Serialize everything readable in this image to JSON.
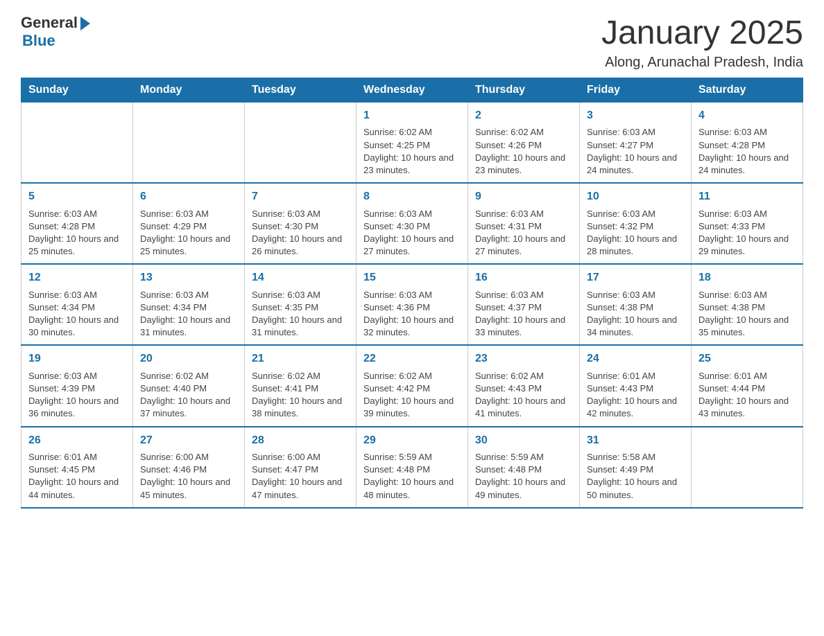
{
  "header": {
    "logo_general": "General",
    "logo_blue": "Blue",
    "month_title": "January 2025",
    "location": "Along, Arunachal Pradesh, India"
  },
  "days_of_week": [
    "Sunday",
    "Monday",
    "Tuesday",
    "Wednesday",
    "Thursday",
    "Friday",
    "Saturday"
  ],
  "weeks": [
    [
      {
        "day": "",
        "info": ""
      },
      {
        "day": "",
        "info": ""
      },
      {
        "day": "",
        "info": ""
      },
      {
        "day": "1",
        "info": "Sunrise: 6:02 AM\nSunset: 4:25 PM\nDaylight: 10 hours and 23 minutes."
      },
      {
        "day": "2",
        "info": "Sunrise: 6:02 AM\nSunset: 4:26 PM\nDaylight: 10 hours and 23 minutes."
      },
      {
        "day": "3",
        "info": "Sunrise: 6:03 AM\nSunset: 4:27 PM\nDaylight: 10 hours and 24 minutes."
      },
      {
        "day": "4",
        "info": "Sunrise: 6:03 AM\nSunset: 4:28 PM\nDaylight: 10 hours and 24 minutes."
      }
    ],
    [
      {
        "day": "5",
        "info": "Sunrise: 6:03 AM\nSunset: 4:28 PM\nDaylight: 10 hours and 25 minutes."
      },
      {
        "day": "6",
        "info": "Sunrise: 6:03 AM\nSunset: 4:29 PM\nDaylight: 10 hours and 25 minutes."
      },
      {
        "day": "7",
        "info": "Sunrise: 6:03 AM\nSunset: 4:30 PM\nDaylight: 10 hours and 26 minutes."
      },
      {
        "day": "8",
        "info": "Sunrise: 6:03 AM\nSunset: 4:30 PM\nDaylight: 10 hours and 27 minutes."
      },
      {
        "day": "9",
        "info": "Sunrise: 6:03 AM\nSunset: 4:31 PM\nDaylight: 10 hours and 27 minutes."
      },
      {
        "day": "10",
        "info": "Sunrise: 6:03 AM\nSunset: 4:32 PM\nDaylight: 10 hours and 28 minutes."
      },
      {
        "day": "11",
        "info": "Sunrise: 6:03 AM\nSunset: 4:33 PM\nDaylight: 10 hours and 29 minutes."
      }
    ],
    [
      {
        "day": "12",
        "info": "Sunrise: 6:03 AM\nSunset: 4:34 PM\nDaylight: 10 hours and 30 minutes."
      },
      {
        "day": "13",
        "info": "Sunrise: 6:03 AM\nSunset: 4:34 PM\nDaylight: 10 hours and 31 minutes."
      },
      {
        "day": "14",
        "info": "Sunrise: 6:03 AM\nSunset: 4:35 PM\nDaylight: 10 hours and 31 minutes."
      },
      {
        "day": "15",
        "info": "Sunrise: 6:03 AM\nSunset: 4:36 PM\nDaylight: 10 hours and 32 minutes."
      },
      {
        "day": "16",
        "info": "Sunrise: 6:03 AM\nSunset: 4:37 PM\nDaylight: 10 hours and 33 minutes."
      },
      {
        "day": "17",
        "info": "Sunrise: 6:03 AM\nSunset: 4:38 PM\nDaylight: 10 hours and 34 minutes."
      },
      {
        "day": "18",
        "info": "Sunrise: 6:03 AM\nSunset: 4:38 PM\nDaylight: 10 hours and 35 minutes."
      }
    ],
    [
      {
        "day": "19",
        "info": "Sunrise: 6:03 AM\nSunset: 4:39 PM\nDaylight: 10 hours and 36 minutes."
      },
      {
        "day": "20",
        "info": "Sunrise: 6:02 AM\nSunset: 4:40 PM\nDaylight: 10 hours and 37 minutes."
      },
      {
        "day": "21",
        "info": "Sunrise: 6:02 AM\nSunset: 4:41 PM\nDaylight: 10 hours and 38 minutes."
      },
      {
        "day": "22",
        "info": "Sunrise: 6:02 AM\nSunset: 4:42 PM\nDaylight: 10 hours and 39 minutes."
      },
      {
        "day": "23",
        "info": "Sunrise: 6:02 AM\nSunset: 4:43 PM\nDaylight: 10 hours and 41 minutes."
      },
      {
        "day": "24",
        "info": "Sunrise: 6:01 AM\nSunset: 4:43 PM\nDaylight: 10 hours and 42 minutes."
      },
      {
        "day": "25",
        "info": "Sunrise: 6:01 AM\nSunset: 4:44 PM\nDaylight: 10 hours and 43 minutes."
      }
    ],
    [
      {
        "day": "26",
        "info": "Sunrise: 6:01 AM\nSunset: 4:45 PM\nDaylight: 10 hours and 44 minutes."
      },
      {
        "day": "27",
        "info": "Sunrise: 6:00 AM\nSunset: 4:46 PM\nDaylight: 10 hours and 45 minutes."
      },
      {
        "day": "28",
        "info": "Sunrise: 6:00 AM\nSunset: 4:47 PM\nDaylight: 10 hours and 47 minutes."
      },
      {
        "day": "29",
        "info": "Sunrise: 5:59 AM\nSunset: 4:48 PM\nDaylight: 10 hours and 48 minutes."
      },
      {
        "day": "30",
        "info": "Sunrise: 5:59 AM\nSunset: 4:48 PM\nDaylight: 10 hours and 49 minutes."
      },
      {
        "day": "31",
        "info": "Sunrise: 5:58 AM\nSunset: 4:49 PM\nDaylight: 10 hours and 50 minutes."
      },
      {
        "day": "",
        "info": ""
      }
    ]
  ]
}
